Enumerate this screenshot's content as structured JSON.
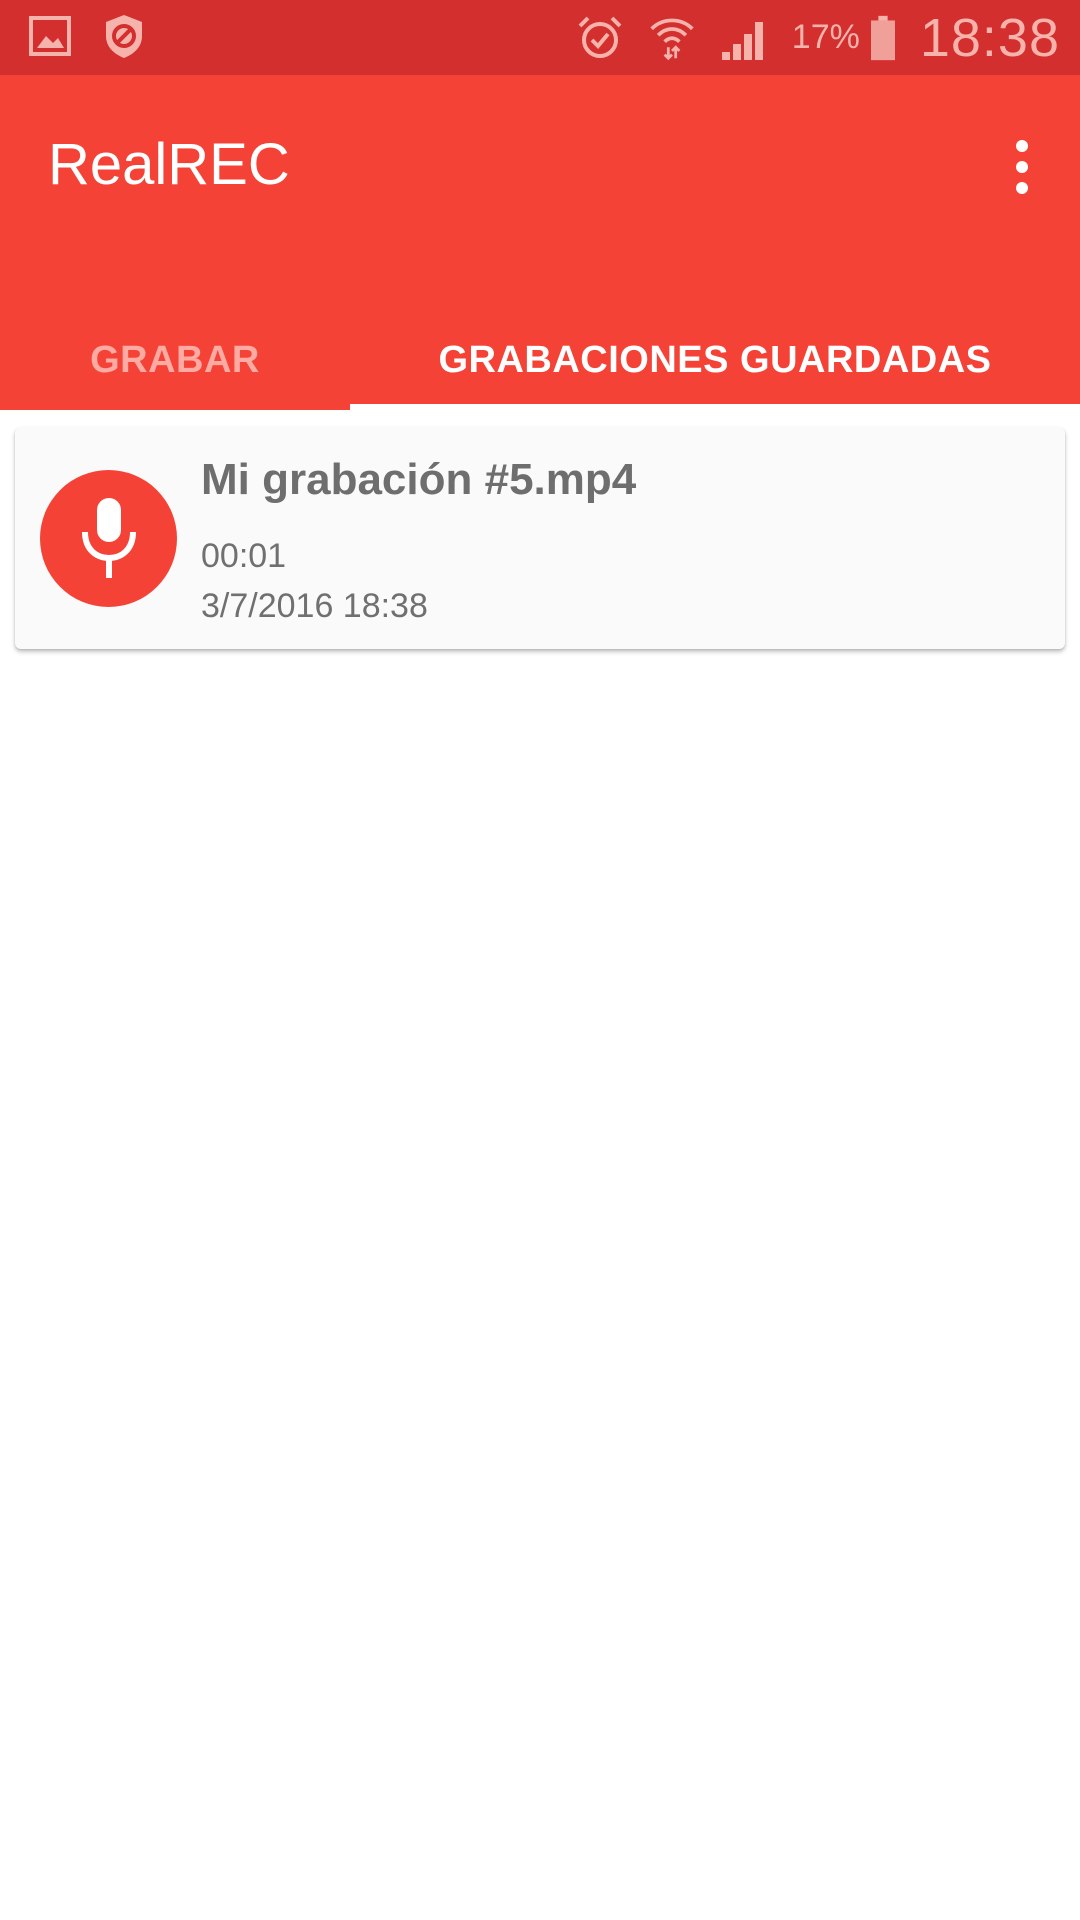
{
  "status_bar": {
    "left_icons": [
      "image-icon",
      "shield-icon"
    ],
    "right_icons": [
      "alarm-icon",
      "wifi-icon",
      "signal-icon",
      "battery-icon"
    ],
    "battery_percent": "17%",
    "time": "18:38"
  },
  "app_bar": {
    "title": "RealREC",
    "overflow_icon": "more-vert-icon",
    "color": "#f44336"
  },
  "tabs": [
    {
      "label": "GRABAR",
      "selected": false
    },
    {
      "label": "GRABACIONES GUARDADAS",
      "selected": true
    }
  ],
  "recordings": [
    {
      "icon": "microphone-icon",
      "name": "Mi grabación #5.mp4",
      "duration": "00:01",
      "date": "3/7/2016 18:38"
    }
  ]
}
